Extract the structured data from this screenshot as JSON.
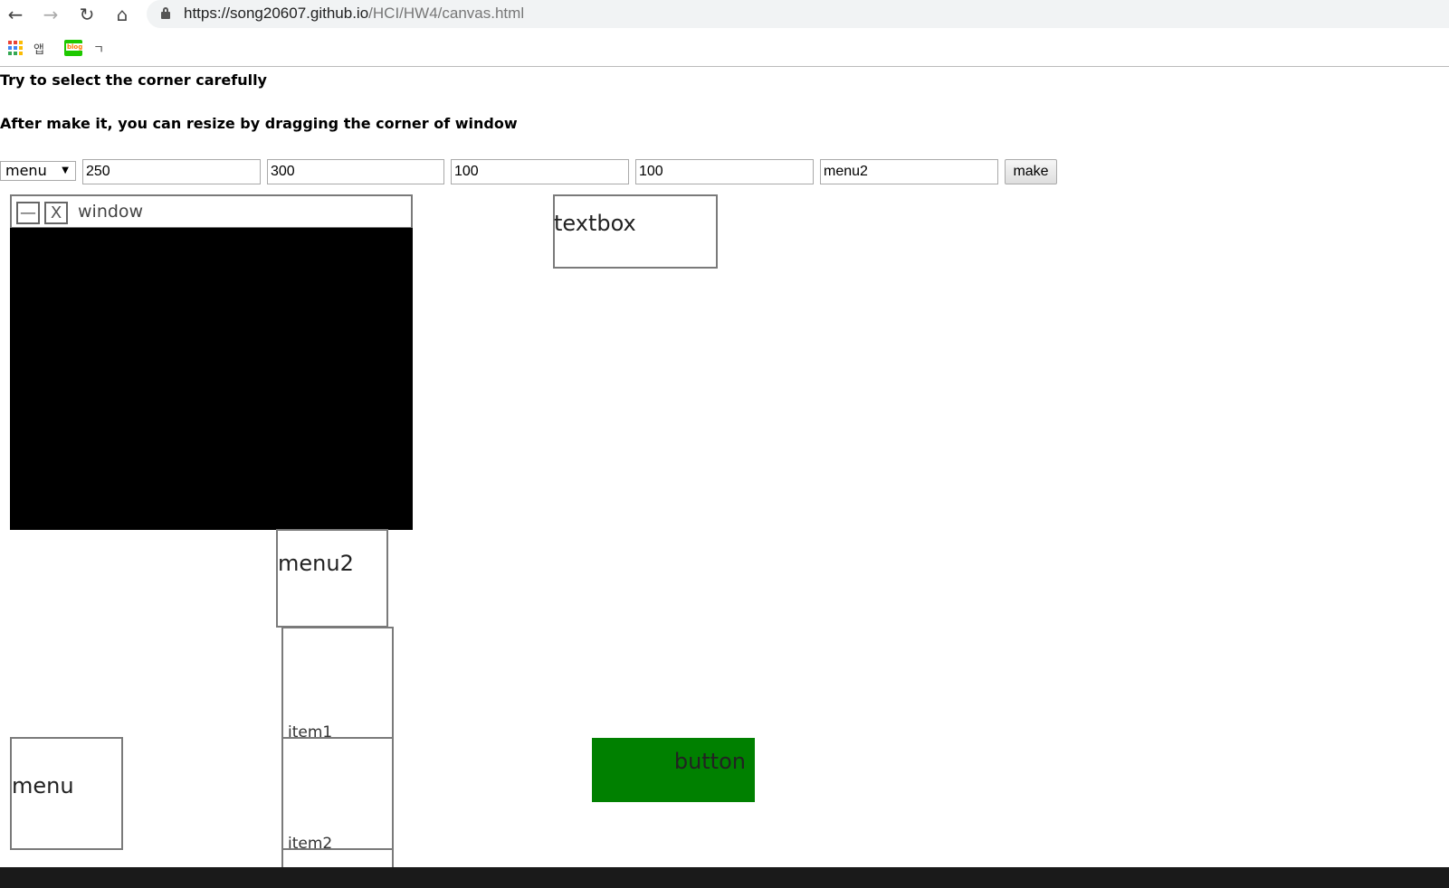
{
  "browser": {
    "url_host": "https://song20607.github.io",
    "url_path": "/HCI/HW4/canvas.html",
    "bookmarks": [
      {
        "label": "앱"
      },
      {
        "label": "ㄱ"
      }
    ]
  },
  "page": {
    "instruction1": "Try to select the corner carefully",
    "instruction2": "After make it, you can resize by dragging the corner of window"
  },
  "form": {
    "type_select": "menu",
    "width": "250",
    "height": "300",
    "x": "100",
    "y": "100",
    "text": "menu2",
    "make_label": "make"
  },
  "canvas": {
    "window": {
      "minimize": "—",
      "close": "X",
      "title": "window"
    },
    "textbox": "textbox",
    "menu2": {
      "label": "menu2",
      "items": [
        "item1",
        "item2"
      ]
    },
    "menu": "menu",
    "button": "button",
    "colors": {
      "button": "#008000",
      "window_body": "#000000"
    }
  }
}
